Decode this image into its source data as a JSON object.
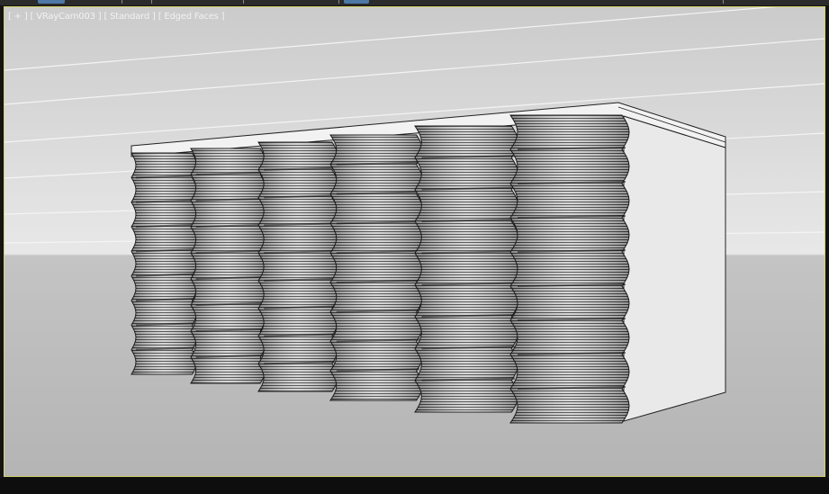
{
  "viewport": {
    "label_menu": "[ + ]",
    "label_camera": "[ VRayCam003 ]",
    "label_shading": "[ Standard ]",
    "label_mode": "[ Edged Faces ]",
    "active_border_color": "#d6d36a"
  },
  "scene": {
    "object": "wavy-panel-facade-block",
    "column_count": 6,
    "colors": {
      "ground": "#bdbdbd",
      "sky_top": "#cfcfcf",
      "sky_horizon": "#e6e6e6",
      "box_face": "#e9e9e9",
      "wave_dark": "#3c3c3c",
      "wave_light": "#d8d8d8"
    }
  }
}
